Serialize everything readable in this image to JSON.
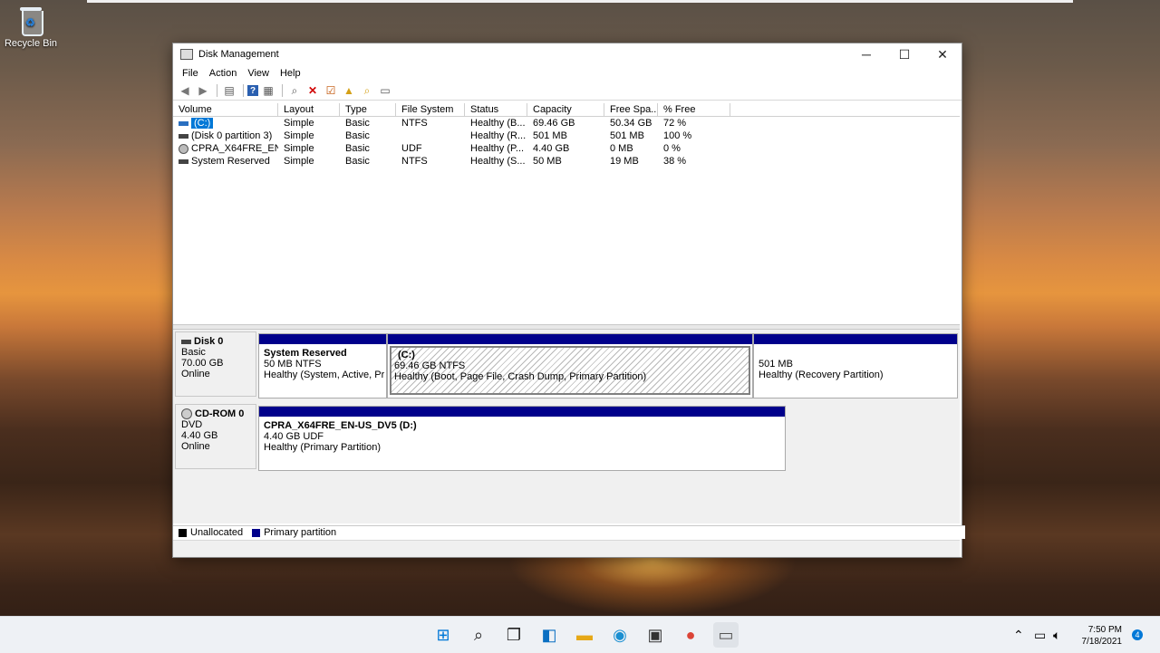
{
  "desktop": {
    "recycle_bin_label": "Recycle Bin"
  },
  "window": {
    "title": "Disk Management",
    "menu": [
      "File",
      "Action",
      "View",
      "Help"
    ],
    "list": {
      "columns": [
        "Volume",
        "Layout",
        "Type",
        "File System",
        "Status",
        "Capacity",
        "Free Spa...",
        "% Free"
      ],
      "rows": [
        {
          "volume": "(C:)",
          "layout": "Simple",
          "type": "Basic",
          "fs": "NTFS",
          "status": "Healthy (B...",
          "capacity": "69.46 GB",
          "free": "50.34 GB",
          "pct": "72 %"
        },
        {
          "volume": "(Disk 0 partition 3)",
          "layout": "Simple",
          "type": "Basic",
          "fs": "",
          "status": "Healthy (R...",
          "capacity": "501 MB",
          "free": "501 MB",
          "pct": "100 %"
        },
        {
          "volume": "CPRA_X64FRE_EN-...",
          "layout": "Simple",
          "type": "Basic",
          "fs": "UDF",
          "status": "Healthy (P...",
          "capacity": "4.40 GB",
          "free": "0 MB",
          "pct": "0 %"
        },
        {
          "volume": "System Reserved",
          "layout": "Simple",
          "type": "Basic",
          "fs": "NTFS",
          "status": "Healthy (S...",
          "capacity": "50 MB",
          "free": "19 MB",
          "pct": "38 %"
        }
      ]
    },
    "disk0": {
      "name": "Disk 0",
      "kind": "Basic",
      "size": "70.00 GB",
      "state": "Online",
      "partitions": [
        {
          "name": "System Reserved",
          "size": "50 MB NTFS",
          "status": "Healthy (System, Active, Pri"
        },
        {
          "name": "(C:)",
          "size": "69.46 GB NTFS",
          "status": "Healthy (Boot, Page File, Crash Dump, Primary Partition)"
        },
        {
          "name": "",
          "size": "501 MB",
          "status": "Healthy (Recovery Partition)"
        }
      ]
    },
    "cdrom0": {
      "name": "CD-ROM 0",
      "kind": "DVD",
      "size": "4.40 GB",
      "state": "Online",
      "partition": {
        "name": "CPRA_X64FRE_EN-US_DV5  (D:)",
        "size": "4.40 GB UDF",
        "status": "Healthy (Primary Partition)"
      }
    },
    "legend": {
      "unallocated": "Unallocated",
      "primary": "Primary partition",
      "unallocated_color": "#000000",
      "primary_color": "#00008b"
    }
  },
  "taskbar": {
    "time": "7:50 PM",
    "date": "7/18/2021",
    "notifications": "4"
  }
}
